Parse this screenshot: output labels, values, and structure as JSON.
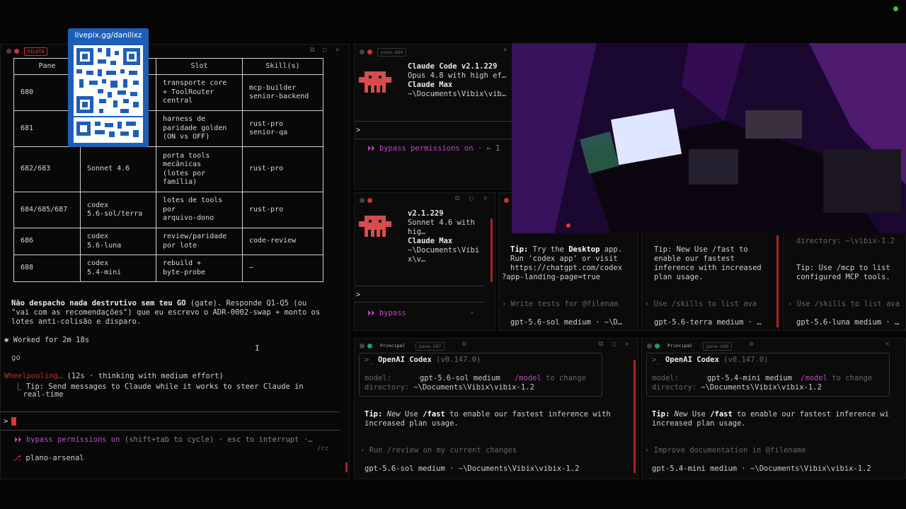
{
  "qr": {
    "label": "livepix.gg/danilixz"
  },
  "main_pane": {
    "tag": "PILOTO",
    "table": {
      "headers": [
        "Pane",
        "",
        "Slot",
        "Skill(s)"
      ],
      "rows": [
        [
          "680",
          "",
          "transporte core\n+ ToolRouter\ncentral",
          "mcp-builder\nsenior-backend"
        ],
        [
          "681",
          "",
          "harness de\nparidade golden\n(ON vs OFF)",
          "rust-pro\nsenior-qa"
        ],
        [
          "682/683",
          "Sonnet 4.6",
          "porta tools\nmecânicas\n(lotes por\nfamília)",
          "rust-pro"
        ],
        [
          "684/685/687",
          "codex\n5.6-sol/terra",
          "lotes de tools\npor\narquivo-dono",
          "rust-pro"
        ],
        [
          "686",
          "codex\n5.6-luna",
          "review/paridade\npor lote",
          "code-review"
        ],
        [
          "688",
          "codex\n5.4-mini",
          "rebuild +\nbyte-probe",
          "—"
        ]
      ]
    },
    "note_bold": "Não despacho nada destrutivo sem teu GO",
    "note_rest": " (gate). Responde Q1-Q5 (ou",
    "note_line2": "\"vai com as recomendações\") que eu escrevo o ADR-0002-swap + monto os",
    "note_line3": "lotes anti-colisão e disparo.",
    "worked": "✱ Worked for 2m 18s",
    "user_go": "go",
    "status_word": "Wheelpooling…",
    "status_rest": " (12s · thinking with medium effort)",
    "tip_line1": "⎿ Tip: Send messages to Claude while it works to steer Claude in",
    "tip_line2": "  real-time",
    "prompt_symbol": ">",
    "bypass": "⏵⏵ bypass permissions on",
    "bypass_rest": " (shift+tab to cycle) · esc to interrupt ·…",
    "rc": "/rc",
    "branch": "plano-arsenal"
  },
  "claude_pane_top": {
    "tag": "pane-680",
    "line1": "Claude Code v2.1.229",
    "line2": "Opus 4.8 with high ef…",
    "line3": "Claude Max",
    "line4": "~\\Documents\\Vibix\\vib…",
    "prompt": ">",
    "bypass": "⏵⏵ bypass permissions on",
    "bypass_rest": " · ← 1"
  },
  "claude_pane_mid": {
    "line1": "v2.1.229",
    "line2": "Sonnet 4.6 with",
    "line3": "hig…",
    "line4": "Claude Max",
    "line5": "~\\Documents\\Vibi",
    "line6": "x\\v…",
    "prompt": ">",
    "bypass": "⏵⏵ bypass",
    "bypass_rest": "·"
  },
  "codex_small_1": {
    "tip_a": "Tip:",
    "tip_b": " Try the ",
    "tip_c": "Desktop",
    "tip_d": " app.",
    "tip_line2": "Run 'codex app' or visit",
    "tip_line3": "https://chatgpt.com/codex",
    "tip_line4": "?app-landing-page=true",
    "suggest": "› Write tests for @filenam",
    "footer": "gpt-5.6-sol medium · ~\\D…"
  },
  "codex_small_2": {
    "tip_line1": "Tip: New Use /fast to",
    "tip_line2": "enable our fastest",
    "tip_line3": "inference with increased",
    "tip_line4": "plan usage.",
    "suggest": "› Use /skills to list ava",
    "footer": "gpt-5.6-terra medium · …"
  },
  "codex_small_3": {
    "dir": "directory: ~\\vibix-1.2",
    "tip_line1": "Tip: Use /mcp to list",
    "tip_line2": "configured MCP tools.",
    "suggest": "› Use /skills to list ava",
    "footer": "gpt-5.6-luna medium · …"
  },
  "codex_left": {
    "tab": "Principal",
    "tag": "pane-687",
    "title": "OpenAI Codex",
    "version": "(v0.147.0)",
    "model_label": "model:",
    "model_value": "gpt-5.6-sol medium",
    "model_cmd": "/model",
    "model_hint": " to change",
    "dir_label": "directory:",
    "dir_value": "~\\Documents\\Vibix\\vibix-1.2",
    "tip_line1_a": "Tip:",
    "tip_line1_b": " New",
    "tip_line1_c": " Use ",
    "tip_line1_d": "/fast",
    "tip_line1_e": " to enable our fastest inference with",
    "tip_line2": "increased plan usage.",
    "suggest": "› Run /review on my current changes",
    "footer": "gpt-5.6-sol medium · ~\\Documents\\Vibix\\vibix-1.2"
  },
  "codex_right": {
    "tab": "Principal",
    "tag": "pane-688",
    "title": "OpenAI Codex",
    "version": "(v0.147.0)",
    "model_label": "model:",
    "model_value": "gpt-5.4-mini medium",
    "model_cmd": "/model",
    "model_hint": " to change",
    "dir_label": "directory:",
    "dir_value": "~\\Documents\\Vibix\\vibix-1.2",
    "tip_line1_a": "Tip:",
    "tip_line1_b": " New",
    "tip_line1_c": " Use ",
    "tip_line1_d": "/fast",
    "tip_line1_e": " to enable our fastest inference wi",
    "tip_line2": "increased plan usage.",
    "suggest": "› Improve documentation in @filename",
    "footer": "gpt-5.4-mini medium · ~\\Documents\\Vibix\\vibix-1.2"
  },
  "colors": {
    "accent_red": "#d43a3a",
    "codex_green": "#22a05a",
    "mascot": "#d94c4c"
  }
}
